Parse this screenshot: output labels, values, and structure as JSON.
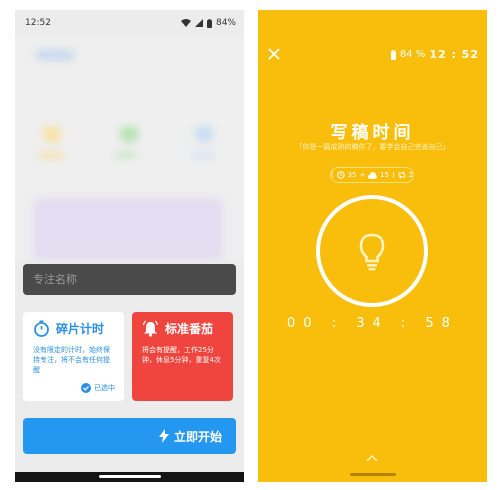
{
  "left": {
    "status_time": "12:52",
    "battery": "84%",
    "focus_name_placeholder": "专注名称",
    "card_fragment": {
      "title": "碎片计时",
      "desc": "没有限定的计时，始终保持专注，将不会有任何提醒",
      "selected_label": "已选中"
    },
    "card_tomato": {
      "title": "标准番茄",
      "desc": "将会有提醒，工作25分钟，休息5分钟，重复4次"
    },
    "start_button": "立即开始"
  },
  "right": {
    "battery": "84 %",
    "time": "12 : 52",
    "title": "写稿时间",
    "subtitle": "「你是一篇成熟的稿件了，要学会自己完善自己」",
    "chip": {
      "work": "35",
      "rest": "15",
      "repeat": "2"
    },
    "timer": "00 : 34 : 58"
  },
  "colors": {
    "yellow": "#f8be0b",
    "blue": "#2497f0",
    "red": "#f0453e",
    "dark_field": "#4a4a4a"
  }
}
